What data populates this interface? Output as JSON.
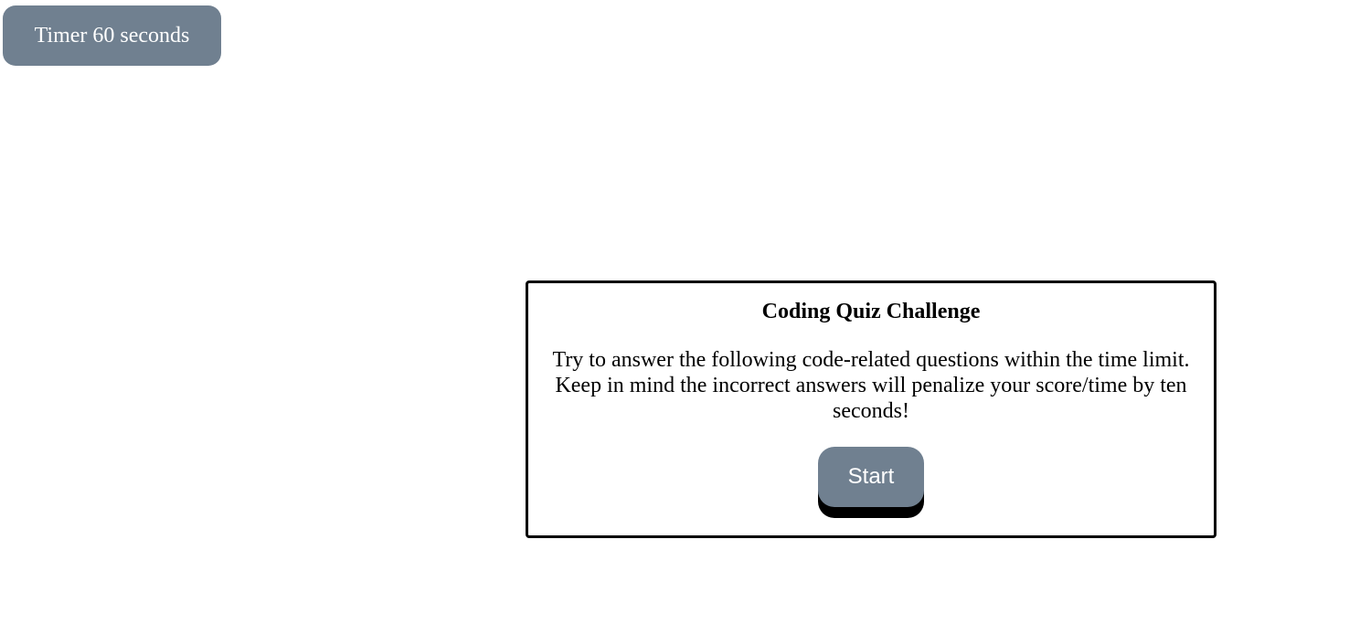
{
  "timer": {
    "label": "Timer 60 seconds"
  },
  "quiz": {
    "title": "Coding Quiz Challenge",
    "description": "Try to answer the following code-related questions within the time limit. Keep in mind the incorrect answers will penalize your score/time by ten seconds!",
    "start_label": "Start"
  },
  "colors": {
    "accent": "#708090",
    "text": "#000000",
    "button_text": "#ffffff",
    "border": "#000000",
    "background": "#ffffff"
  }
}
